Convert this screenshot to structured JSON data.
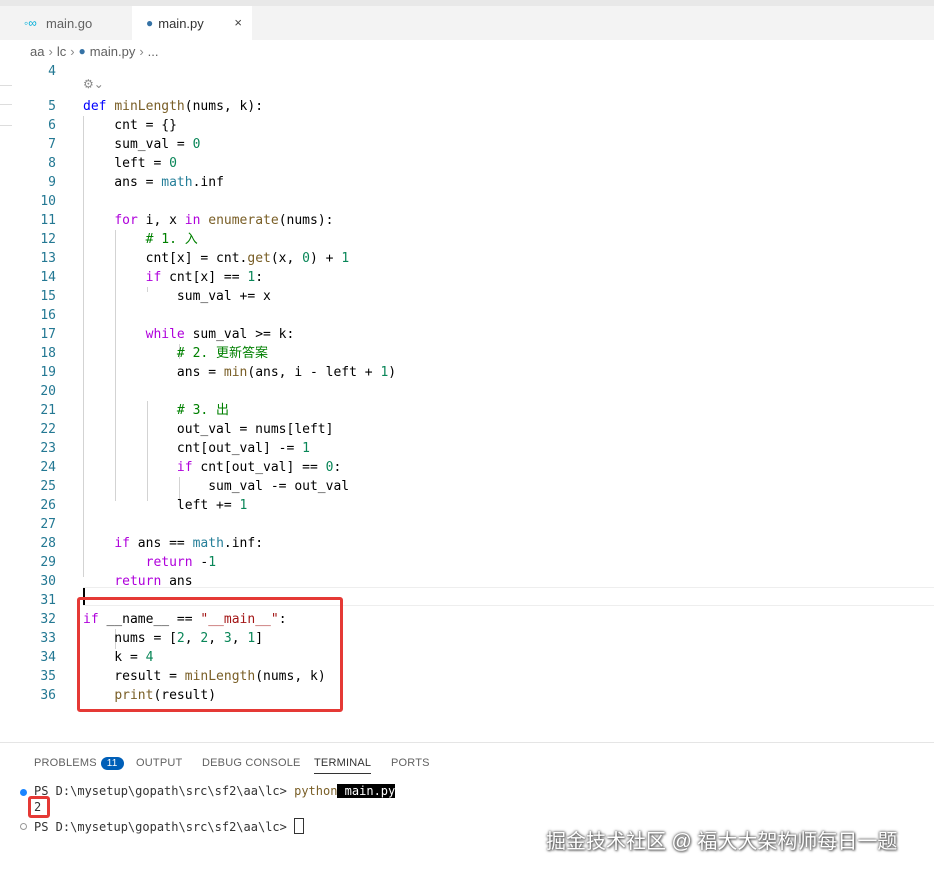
{
  "tabs": [
    {
      "label": "main.go",
      "icon": "go-file-icon",
      "active": false
    },
    {
      "label": "main.py",
      "icon": "python-file-icon",
      "active": true,
      "close": "×"
    }
  ],
  "breadcrumb": {
    "parts": [
      "aa",
      "lc",
      "main.py",
      "..."
    ]
  },
  "editor": {
    "inlay_hint": "⚙⌄",
    "lines": [
      {
        "n": "4",
        "code": ""
      },
      {
        "n": "5",
        "code": "def minLength(nums, k):"
      },
      {
        "n": "6",
        "code": "    cnt = {}"
      },
      {
        "n": "7",
        "code": "    sum_val = 0"
      },
      {
        "n": "8",
        "code": "    left = 0"
      },
      {
        "n": "9",
        "code": "    ans = math.inf"
      },
      {
        "n": "10",
        "code": ""
      },
      {
        "n": "11",
        "code": "    for i, x in enumerate(nums):"
      },
      {
        "n": "12",
        "code": "        # 1. 入"
      },
      {
        "n": "13",
        "code": "        cnt[x] = cnt.get(x, 0) + 1"
      },
      {
        "n": "14",
        "code": "        if cnt[x] == 1:"
      },
      {
        "n": "15",
        "code": "            sum_val += x"
      },
      {
        "n": "16",
        "code": ""
      },
      {
        "n": "17",
        "code": "        while sum_val >= k:"
      },
      {
        "n": "18",
        "code": "            # 2. 更新答案"
      },
      {
        "n": "19",
        "code": "            ans = min(ans, i - left + 1)"
      },
      {
        "n": "20",
        "code": ""
      },
      {
        "n": "21",
        "code": "            # 3. 出"
      },
      {
        "n": "22",
        "code": "            out_val = nums[left]"
      },
      {
        "n": "23",
        "code": "            cnt[out_val] -= 1"
      },
      {
        "n": "24",
        "code": "            if cnt[out_val] == 0:"
      },
      {
        "n": "25",
        "code": "                sum_val -= out_val"
      },
      {
        "n": "26",
        "code": "            left += 1"
      },
      {
        "n": "27",
        "code": ""
      },
      {
        "n": "28",
        "code": "    if ans == math.inf:"
      },
      {
        "n": "29",
        "code": "        return -1"
      },
      {
        "n": "30",
        "code": "    return ans"
      },
      {
        "n": "31",
        "code": ""
      },
      {
        "n": "32",
        "code": "if __name__ == \"__main__\":"
      },
      {
        "n": "33",
        "code": "    nums = [2, 2, 3, 1]"
      },
      {
        "n": "34",
        "code": "    k = 4"
      },
      {
        "n": "35",
        "code": "    result = minLength(nums, k)"
      },
      {
        "n": "36",
        "code": "    print(result)"
      }
    ]
  },
  "panel": {
    "tabs": [
      {
        "label": "PROBLEMS",
        "badge": "11"
      },
      {
        "label": "OUTPUT"
      },
      {
        "label": "DEBUG CONSOLE"
      },
      {
        "label": "TERMINAL",
        "active": true
      },
      {
        "label": "PORTS"
      }
    ],
    "terminal": {
      "prompt1": "PS D:\\mysetup\\gopath\\src\\sf2\\aa\\lc> ",
      "cmd_python": "python",
      "cmd_file": " main.py",
      "output": "2",
      "prompt2": "PS D:\\mysetup\\gopath\\src\\sf2\\aa\\lc> "
    }
  },
  "watermark": "掘金技术社区 @ 福大大架构师每日一题",
  "colors": {
    "highlight_box": "#e53935",
    "line_number": "#237893",
    "keyword": "#af00db",
    "function": "#795e26",
    "number": "#098658",
    "comment": "#008000"
  }
}
